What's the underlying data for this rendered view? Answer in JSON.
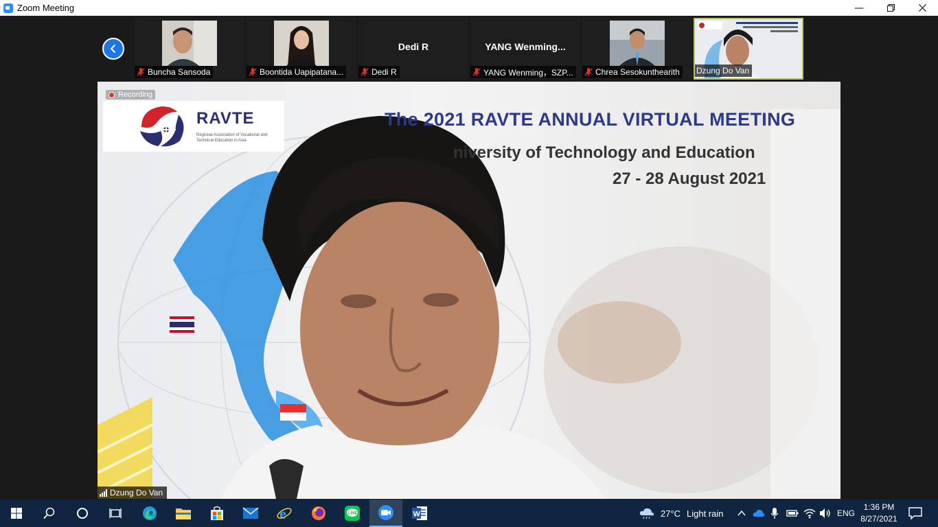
{
  "window": {
    "title": "Zoom Meeting"
  },
  "participants": [
    {
      "name": "Buncha Sansoda",
      "has_video": true,
      "muted": true
    },
    {
      "name": "Boontida Uapipatana...",
      "has_video": true,
      "muted": true
    },
    {
      "name": "Dedi R",
      "display": "Dedi R",
      "has_video": false,
      "muted": true
    },
    {
      "name": "YANG Wenming，SZP...",
      "display": "YANG  Wenming...",
      "has_video": false,
      "muted": true
    },
    {
      "name": "Chrea Sesokunthearith",
      "has_video": true,
      "muted": true
    },
    {
      "name": "Dzung Do Van",
      "has_video": true,
      "muted": false,
      "active": true
    }
  ],
  "main": {
    "recording_label": "Recording",
    "speaker_name": "Dzung Do Van",
    "logo_text": "RAVTE",
    "logo_subtitle": "Regional Association of Vocational and Technical Education in Asia",
    "banner_line1": "The 2021 RAVTE ANNUAL VIRTUAL MEETING",
    "banner_line2": "niversity of Technology and Education",
    "banner_line3": "27 - 28 August 2021"
  },
  "taskbar": {
    "weather_temp": "27°C",
    "weather_desc": "Light rain",
    "language": "ENG",
    "time": "1:36 PM",
    "date": "8/27/2021"
  },
  "colors": {
    "zoom_blue": "#2d8cff",
    "active_border": "#b4c66b",
    "taskbar": "#0f2540",
    "mute_red": "#e0312b"
  }
}
